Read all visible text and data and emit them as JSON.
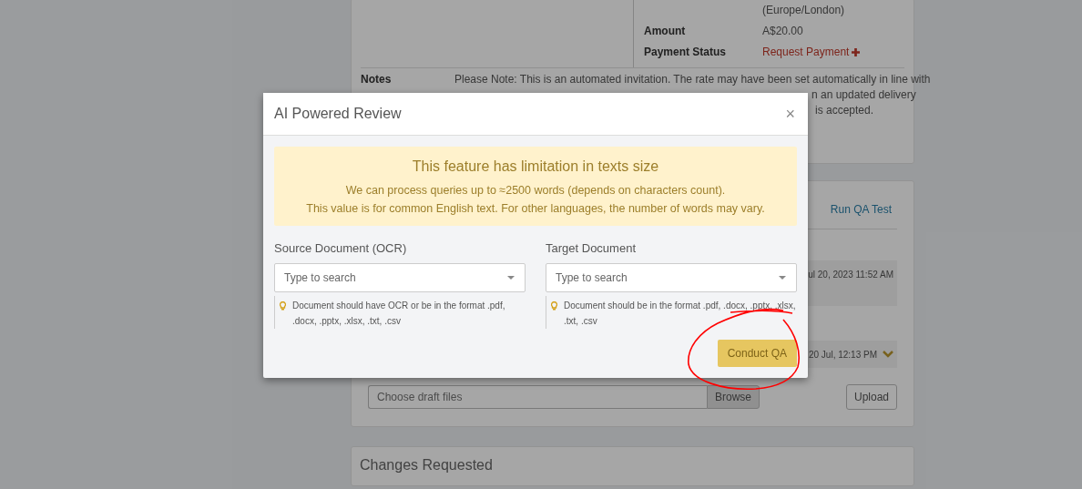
{
  "page": {
    "timezone_note": "(Europe/London)",
    "details": [
      {
        "label": "Amount",
        "value": "A$20.00",
        "kind": "text"
      },
      {
        "label": "Payment Status",
        "value": "Request Payment",
        "kind": "link"
      }
    ],
    "notes": {
      "label": "Notes",
      "text": "Please Note: This is an automated invitation. The rate may have been set automatically in line with",
      "visible_fragments": [
        "n an updated delivery",
        "is accepted."
      ]
    },
    "qa_card": {
      "link": "Run QA Test",
      "entries": [
        {
          "timestamp": "ul 20, 2023 11:52 AM",
          "kind": "plain"
        },
        {
          "timestamp": "20 Jul, 12:13 PM",
          "kind": "collapsible"
        }
      ],
      "file_input": {
        "placeholder": "Choose draft files",
        "button": "Browse"
      },
      "upload_button": "Upload"
    },
    "changes_card": {
      "title": "Changes Requested"
    }
  },
  "modal": {
    "title": "AI Powered Review",
    "close": "×",
    "alert": {
      "title": "This feature has limitation in texts size",
      "lines": [
        "We can process queries up to ≈2500 words (depends on characters count).",
        "This value is for common English text. For other languages, the number of words may vary."
      ]
    },
    "fields": [
      {
        "label": "Source Document (OCR)",
        "placeholder": "Type to search",
        "hint": "Document should have OCR or be in the format .pdf, .docx, .pptx, .xlsx, .txt, .csv"
      },
      {
        "label": "Target Document",
        "placeholder": "Type to search",
        "hint": "Document should be in the format .pdf, .docx, .pptx, .xlsx, .txt, .csv"
      }
    ],
    "submit": {
      "label": "Conduct QA",
      "disabled": true
    }
  },
  "annotation": {
    "kind": "circle"
  }
}
